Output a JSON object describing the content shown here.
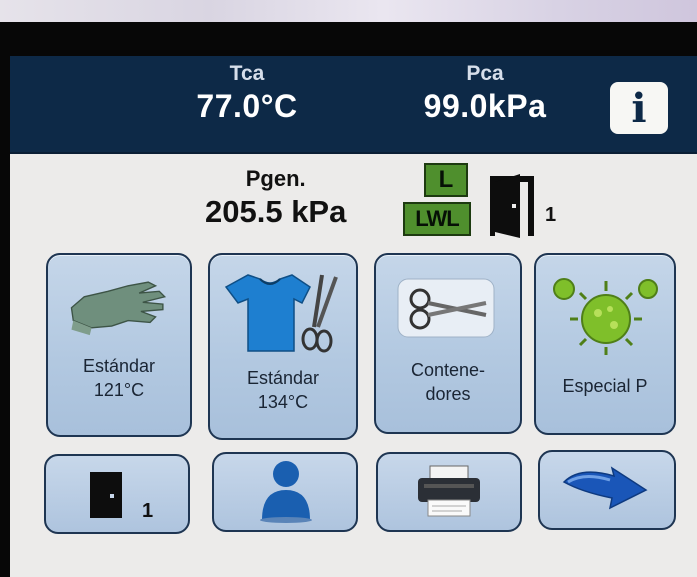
{
  "status_bar": {
    "chamber_temp": {
      "label": "Tca",
      "value": "77.0°C"
    },
    "chamber_pressure": {
      "label": "Pca",
      "value": "99.0kPa"
    },
    "info_label": "i"
  },
  "generator": {
    "label": "Pgen.",
    "value": "205.5 kPa",
    "badges": {
      "level": "L",
      "low_water": "LWL"
    },
    "door_number": "1"
  },
  "programs": [
    {
      "line1": "Estándar",
      "line2": "121°C",
      "icon": "glove-icon"
    },
    {
      "line1": "Estándar",
      "line2": "134°C",
      "icon": "shirt-scissors-icon"
    },
    {
      "line1": "Contene-",
      "line2": "dores",
      "icon": "scissors-icon"
    },
    {
      "line1": "Especial P",
      "line2": "",
      "icon": "virus-icon"
    }
  ],
  "bottom_bar": {
    "door_number": "1",
    "icons": [
      "door-icon",
      "user-icon",
      "printer-icon",
      "next-arrow-icon"
    ]
  },
  "colors": {
    "header": "#0d2947",
    "screen_bg": "#ecebea",
    "tile": "#b3c9e1",
    "badge_green": "#4f8f2d"
  }
}
